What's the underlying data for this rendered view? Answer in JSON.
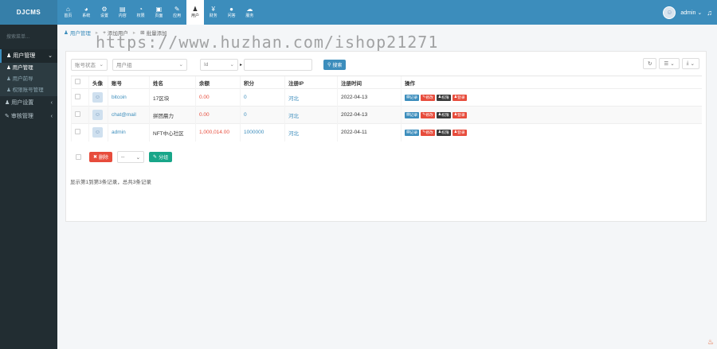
{
  "app": {
    "logo": "DJCMS",
    "user": "admin"
  },
  "topnav": [
    {
      "icon": "⌂",
      "label": "首页",
      "active": false
    },
    {
      "icon": "◕",
      "label": "系统",
      "active": false
    },
    {
      "icon": "⚙",
      "label": "设置",
      "active": false
    },
    {
      "icon": "▤",
      "label": "内容",
      "active": false
    },
    {
      "icon": "◔",
      "label": "权限",
      "active": false
    },
    {
      "icon": "▣",
      "label": "页面",
      "active": false
    },
    {
      "icon": "✎",
      "label": "应用",
      "active": false
    },
    {
      "icon": "♟",
      "label": "用户",
      "active": true
    },
    {
      "icon": "¥",
      "label": "财务",
      "active": false
    },
    {
      "icon": "●",
      "label": "问答",
      "active": false
    },
    {
      "icon": "☁",
      "label": "服务",
      "active": false
    }
  ],
  "sidebar": {
    "search_placeholder": "搜索菜单...",
    "groups": [
      {
        "label": "用户管理",
        "icon": "♟",
        "open": true,
        "items": [
          {
            "label": "用户管理",
            "active": true
          },
          {
            "label": "用户前导",
            "active": false
          },
          {
            "label": "权限账号管理",
            "active": false
          }
        ]
      },
      {
        "label": "用户设置",
        "icon": "♟",
        "open": false,
        "items": []
      },
      {
        "label": "审核管理",
        "icon": "✎",
        "open": false,
        "items": []
      }
    ]
  },
  "breadcrumbs": {
    "tab1": "用户管理",
    "tab2": "添加用户",
    "tab3": "批量添加",
    "watermark": "https://www.huzhan.com/ishop21271"
  },
  "filters": {
    "status": "账号状态",
    "usergroup": "用户组",
    "field": "Id",
    "search_button": "搜索"
  },
  "toolbar": {
    "refresh": "↻",
    "columns": "☰",
    "export": "⤓"
  },
  "table": {
    "columns": [
      "头像",
      "账号",
      "姓名",
      "余额",
      "积分",
      "注册IP",
      "注册时间",
      "操作"
    ],
    "rows": [
      {
        "account": "bitcoin",
        "name": "17区块",
        "balance": "0.00",
        "points": "0",
        "ip": "河北",
        "date": "2022-04-13"
      },
      {
        "account": "chat@mail",
        "name": "拼团晨力",
        "balance": "0.00",
        "points": "0",
        "ip": "河北",
        "date": "2022-04-13"
      },
      {
        "account": "admin",
        "name": "NFT中心社区",
        "balance": "1,000,014.00",
        "points": "1000000",
        "ip": "河北",
        "date": "2022-04-11"
      }
    ],
    "op_labels": {
      "record": "记录",
      "edit": "修改",
      "perm": "权限",
      "login": "登录"
    }
  },
  "bottom": {
    "delete_label": "删除",
    "more_value": "--",
    "apply_label": "分组",
    "pagination": "显示第1到第3条记录，总共3条记录"
  }
}
